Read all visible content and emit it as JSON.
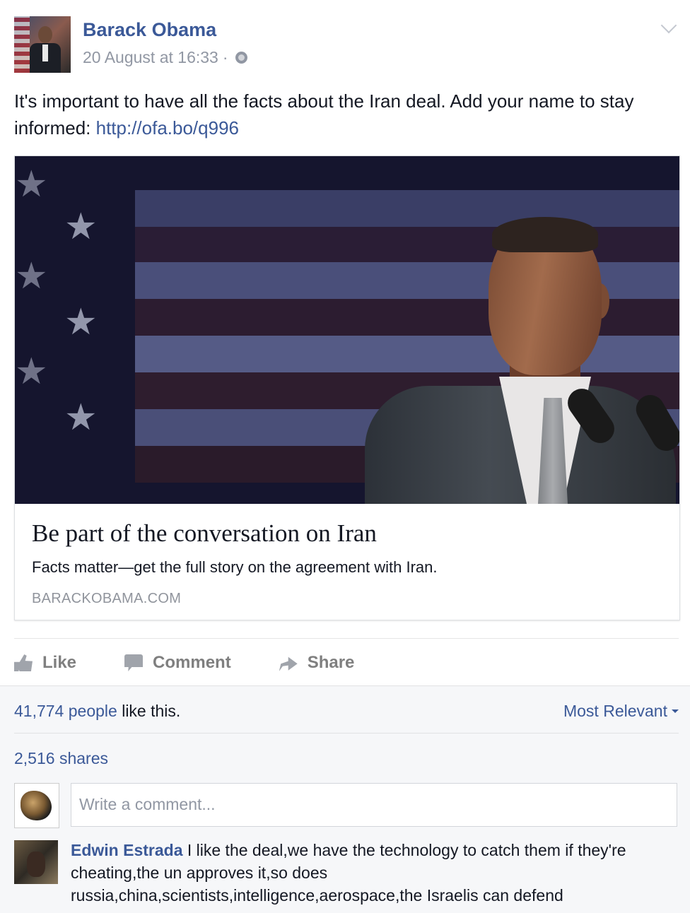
{
  "post": {
    "author": "Barack Obama",
    "timestamp": "20 August at 16:33",
    "separator": "·",
    "text": "It's important to have all the facts about the Iran deal. Add your name to stay informed: ",
    "link": "http://ofa.bo/q996"
  },
  "card": {
    "title": "Be part of the conversation on Iran",
    "description": "Facts matter—get the full story on the agreement with Iran.",
    "domain": "BARACKOBAMA.COM"
  },
  "actions": {
    "like": "Like",
    "comment": "Comment",
    "share": "Share"
  },
  "footer": {
    "likes_count": "41,774 people",
    "likes_suffix": " like this.",
    "sort": "Most Relevant",
    "shares": "2,516 shares",
    "comment_placeholder": "Write a comment..."
  },
  "comments": [
    {
      "author": "Edwin Estrada",
      "text": " I like the deal,we have the technology to catch them if they're cheating,the un approves it,so does russia,china,scientists,intelligence,aerospace,the Israelis can defend"
    }
  ],
  "icons": {
    "globe": "globe-icon",
    "chevron": "chevron-down-icon",
    "like": "thumbs-up-icon",
    "comment": "speech-bubble-icon",
    "share": "share-arrow-icon"
  },
  "colors": {
    "link": "#3b5998",
    "meta": "#9197a3",
    "footer_bg": "#f6f7f9"
  }
}
